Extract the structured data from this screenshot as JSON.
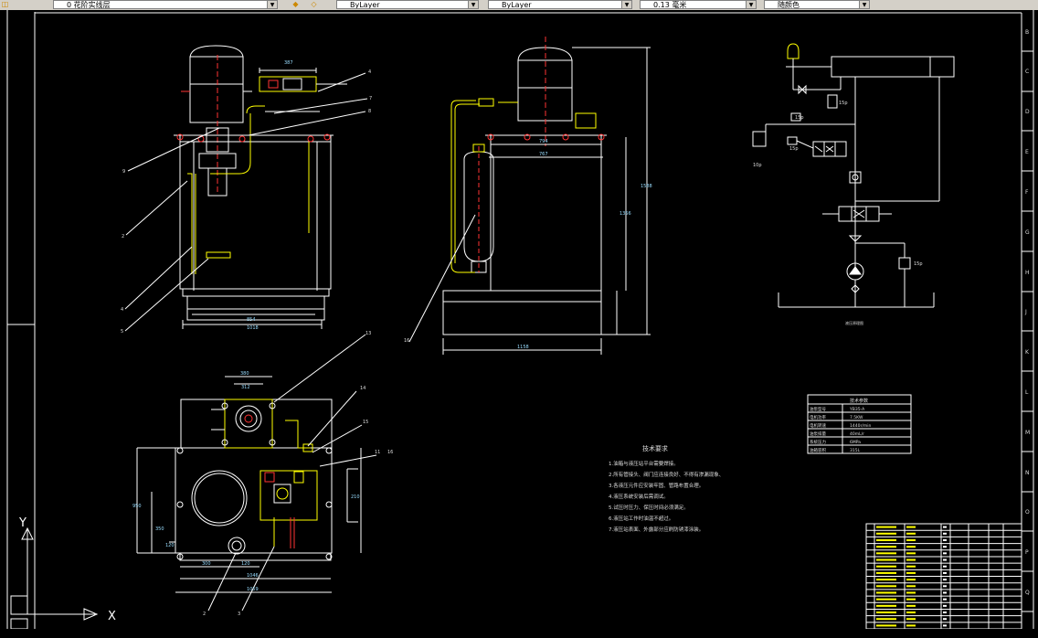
{
  "toolbar": {
    "layer_name": "0 花阶实线层",
    "color_value": "ByLayer",
    "linetype_value": "ByLayer",
    "lineweight_value": "0.13 毫米",
    "plotstyle_value": "随颜色"
  },
  "drawing": {
    "front_view_dims": [
      "387",
      "1018",
      "854"
    ],
    "side_view_dims": [
      "794",
      "767",
      "1158",
      "1588",
      "1356"
    ],
    "top_view_dims": [
      "380",
      "312",
      "1046",
      "1059",
      "300",
      "120",
      "950",
      "350",
      "120",
      "210"
    ],
    "top_labels": [
      "13",
      "14",
      "15",
      "11",
      "16",
      "2",
      "3"
    ],
    "tech_req": {
      "title": "技术要求",
      "items": [
        "1.油箱与液压站平台需要焊接。",
        "2.所有管接头、阀门应连接良好、不得有渗漏现象、",
        "3.各液压元件应安装牢固、管路布置合理。",
        "4.液压系统安装后需调试。",
        "5.试压时压力、保压时间必须满足。",
        "6.液压站工作时油温不超过。",
        "7.液压站表面、外露部分应刷防锈漆涂装。"
      ]
    },
    "spec_table": {
      "title": "技术参数",
      "rows": [
        [
          "油泵型号",
          "YB35-A"
        ],
        [
          "电机功率",
          "7.5KW"
        ],
        [
          "电机转速",
          "1440r/min"
        ],
        [
          "油泵排量",
          "40mL/r"
        ],
        [
          "系统压力",
          "6MPa"
        ],
        [
          "油箱容积",
          "315L"
        ]
      ]
    },
    "hyd_labels": [
      "15p",
      "15p",
      "10p",
      "15p",
      "15p"
    ],
    "schematic_caption": "液压原理图",
    "axis_y": "Y",
    "axis_x": "X",
    "border_letters": [
      "B",
      "C",
      "D",
      "E",
      "F",
      "G",
      "H",
      "J",
      "K",
      "L",
      "M",
      "N",
      "O",
      "P",
      "Q"
    ]
  }
}
